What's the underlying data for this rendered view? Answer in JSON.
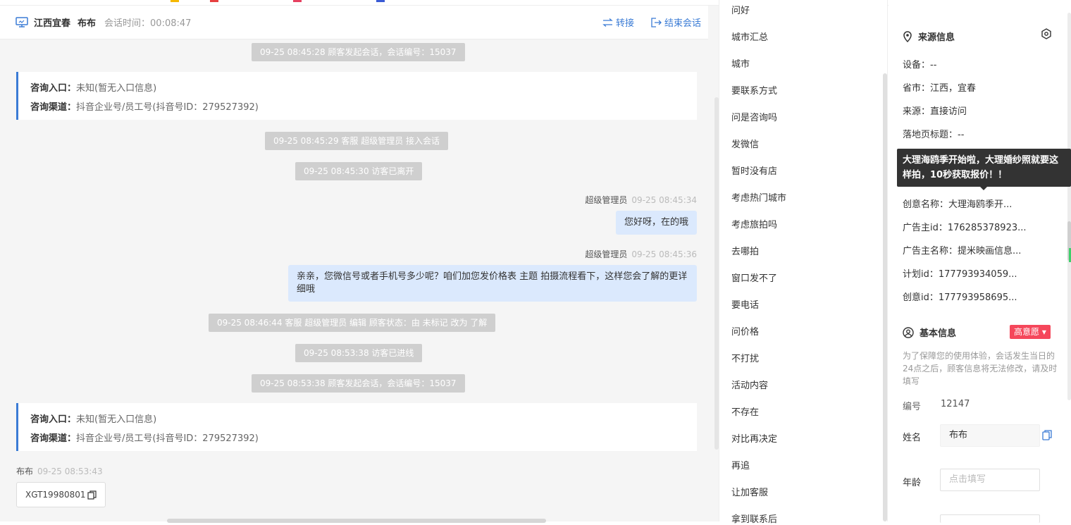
{
  "header": {
    "location": "江西宜春",
    "customer": "布布",
    "session_time": "会话时间：00:08:47",
    "transfer_label": "转接",
    "end_label": "结束会话"
  },
  "messages": {
    "sys1": "09-25 08:45:28 顾客发起会话，会话编号：15037",
    "card1_entry_label": "咨询入口：",
    "card1_entry_value": "未知(暂无入口信息)",
    "card1_channel_label": "咨询渠道：",
    "card1_channel_value": "抖音企业号/员工号(抖音号ID：279527392)",
    "sys2": "09-25 08:45:29 客服 超级管理员 接入会话",
    "sys3": "09-25 08:45:30 访客已离开",
    "agent1_name": "超级管理员",
    "agent1_time": "09-25 08:45:34",
    "agent1_text": "您好呀，在的哦",
    "agent2_name": "超级管理员",
    "agent2_time": "09-25 08:45:36",
    "agent2_text": "亲亲，您微信号或者手机号多少呢？咱们加您发价格表 主题 拍摄流程看下，这样您会了解的更详细哦",
    "sys4": "09-25 08:46:44 客服 超级管理员 编辑 顾客状态：由 未标记 改为 了解",
    "sys5": "09-25 08:53:38 访客已进线",
    "sys6": "09-25 08:53:38 顾客发起会话，会话编号：15037",
    "card2_entry_label": "咨询入口：",
    "card2_entry_value": "未知(暂无入口信息)",
    "card2_channel_label": "咨询渠道：",
    "card2_channel_value": "抖音企业号/员工号(抖音号ID：279527392)",
    "client_name": "布布",
    "client_time": "09-25 08:53:43",
    "client_text": "XGT19980801"
  },
  "quick_replies": [
    "问好",
    "城市汇总",
    "城市",
    "要联系方式",
    "问是咨询吗",
    "发微信",
    "暂时没有店",
    "考虑热门城市",
    "考虑旅拍吗",
    "去哪拍",
    "窗口发不了",
    "要电话",
    "问价格",
    "不打扰",
    "活动内容",
    "不存在",
    "对比再决定",
    "再追",
    "让加客服",
    "拿到联系后"
  ],
  "source_info": {
    "title": "来源信息",
    "device": "设备：--",
    "province_city": "省市：江西，宜春",
    "source": "来源：直接访问",
    "landing_title": "落地页标题：--",
    "creative_name": "创意名称：大理海鸥季开...",
    "advertiser_id": "广告主id：176285378923...",
    "advertiser_name": "广告主名称：提米映画信息...",
    "plan_id": "计划id：177793934059...",
    "creative_id": "创意id：177793958695...",
    "tooltip": "大理海鸥季开始啦，大理婚纱照就要这样拍，10秒获取报价！！"
  },
  "basic_info": {
    "title": "基本信息",
    "intent_tag": "高意愿",
    "note": "为了保障您的使用体验，会话发生当日的24点之后，顾客信息将无法修改，请及时填写",
    "id_label": "编号",
    "id_value": "12147",
    "name_label": "姓名",
    "name_value": "布布",
    "age_label": "年龄",
    "age_placeholder": "点击填写"
  },
  "colors": {
    "accent": "#3a7bd5",
    "system_bg": "#cfcfcf",
    "agent_bubble": "#dbe9fd",
    "intent_tag": "#f5475b"
  }
}
